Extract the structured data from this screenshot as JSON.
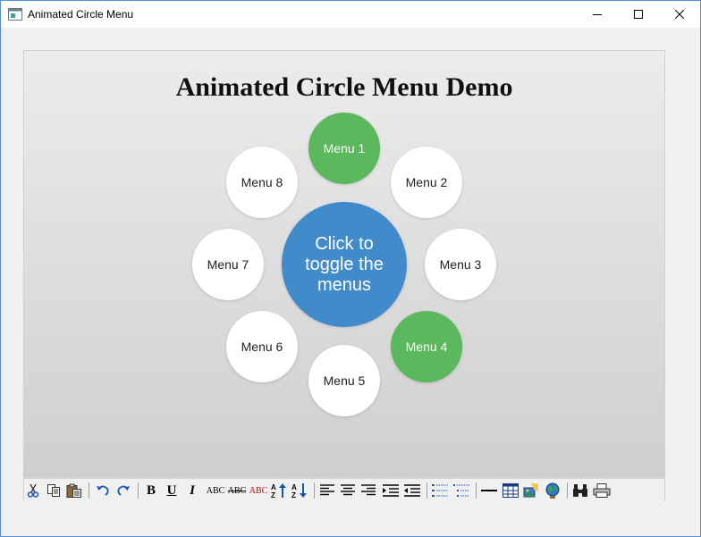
{
  "window": {
    "title": "Animated Circle Menu"
  },
  "demo": {
    "title": "Animated Circle Menu Demo",
    "center_label": "Click to toggle the menus",
    "menus": [
      {
        "label": "Menu 1",
        "active": true
      },
      {
        "label": "Menu 2",
        "active": false
      },
      {
        "label": "Menu 3",
        "active": false
      },
      {
        "label": "Menu 4",
        "active": true
      },
      {
        "label": "Menu 5",
        "active": false
      },
      {
        "label": "Menu 6",
        "active": false
      },
      {
        "label": "Menu 7",
        "active": false
      },
      {
        "label": "Menu 8",
        "active": false
      }
    ]
  },
  "toolbar": {
    "bold": "B",
    "underline": "U",
    "italic": "I",
    "abc_normal": "ABC",
    "abc_strike": "ABC",
    "abc_color": "ABC"
  },
  "colors": {
    "center_blue": "#428bca",
    "active_green": "#5cb85c",
    "menu_white": "#ffffff"
  }
}
